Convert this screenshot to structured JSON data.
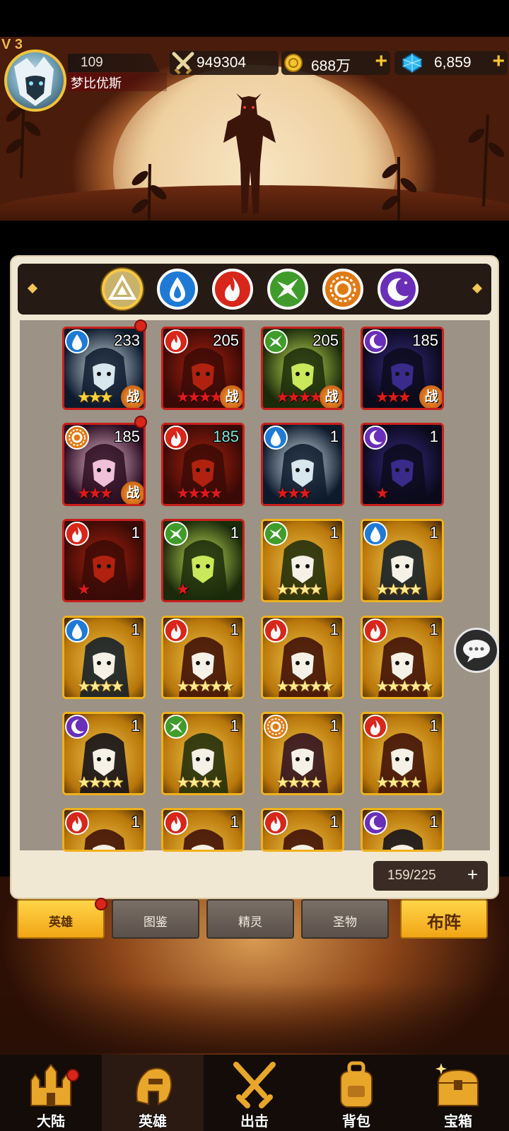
{
  "player": {
    "vip_label": "V 3",
    "level": "109",
    "name": "梦比优斯"
  },
  "resources": {
    "power": "949304",
    "gold": "688万",
    "gems": "6,859",
    "plus": "+"
  },
  "elements": [
    "all",
    "water",
    "fire",
    "wind",
    "light",
    "dark"
  ],
  "heroes": [
    {
      "element": "water",
      "level": "233",
      "stars": 3,
      "star_type": "gold-crown",
      "battle": "战",
      "frame": "red",
      "dot": true
    },
    {
      "element": "fire",
      "level": "205",
      "stars": 4,
      "star_type": "red",
      "battle": "战",
      "frame": "red",
      "dot": false
    },
    {
      "element": "wind",
      "level": "205",
      "stars": 4,
      "star_type": "red",
      "battle": "战",
      "frame": "red",
      "dot": false
    },
    {
      "element": "dark",
      "level": "185",
      "stars": 3,
      "star_type": "red",
      "battle": "战",
      "frame": "red",
      "dot": false
    },
    {
      "element": "light",
      "level": "185",
      "stars": 3,
      "star_type": "red",
      "battle": "战",
      "frame": "red",
      "dot": true
    },
    {
      "element": "fire",
      "level": "185",
      "stars": 4,
      "star_type": "red",
      "battle": "",
      "frame": "red",
      "dot": false,
      "teal": true
    },
    {
      "element": "water",
      "level": "1",
      "stars": 3,
      "star_type": "red",
      "battle": "",
      "frame": "red",
      "dot": false
    },
    {
      "element": "dark",
      "level": "1",
      "stars": 1,
      "star_type": "red",
      "battle": "",
      "frame": "red",
      "dot": false
    },
    {
      "element": "fire",
      "level": "1",
      "stars": 1,
      "star_type": "red",
      "battle": "",
      "frame": "red",
      "dot": false
    },
    {
      "element": "wind",
      "level": "1",
      "stars": 1,
      "star_type": "red",
      "battle": "",
      "frame": "red",
      "dot": false
    },
    {
      "element": "wind",
      "level": "1",
      "stars": 4,
      "star_type": "gold",
      "battle": "",
      "frame": "gold",
      "dot": false
    },
    {
      "element": "water",
      "level": "1",
      "stars": 4,
      "star_type": "gold",
      "battle": "",
      "frame": "gold",
      "dot": false
    },
    {
      "element": "water",
      "level": "1",
      "stars": 4,
      "star_type": "gold",
      "battle": "",
      "frame": "gold",
      "dot": false
    },
    {
      "element": "fire",
      "level": "1",
      "stars": 5,
      "star_type": "gold",
      "battle": "",
      "frame": "gold",
      "dot": false
    },
    {
      "element": "fire",
      "level": "1",
      "stars": 5,
      "star_type": "gold",
      "battle": "",
      "frame": "gold",
      "dot": false
    },
    {
      "element": "fire",
      "level": "1",
      "stars": 5,
      "star_type": "gold",
      "battle": "",
      "frame": "gold",
      "dot": false
    },
    {
      "element": "dark",
      "level": "1",
      "stars": 4,
      "star_type": "gold",
      "battle": "",
      "frame": "gold",
      "dot": false
    },
    {
      "element": "wind",
      "level": "1",
      "stars": 4,
      "star_type": "gold",
      "battle": "",
      "frame": "gold",
      "dot": false
    },
    {
      "element": "light",
      "level": "1",
      "stars": 4,
      "star_type": "gold",
      "battle": "",
      "frame": "gold",
      "dot": false
    },
    {
      "element": "fire",
      "level": "1",
      "stars": 4,
      "star_type": "gold",
      "battle": "",
      "frame": "gold",
      "dot": false
    },
    {
      "element": "fire",
      "level": "1",
      "stars": 0,
      "star_type": "gold",
      "battle": "",
      "frame": "gold",
      "dot": false
    },
    {
      "element": "fire",
      "level": "1",
      "stars": 0,
      "star_type": "gold",
      "battle": "",
      "frame": "gold",
      "dot": false
    },
    {
      "element": "fire",
      "level": "1",
      "stars": 0,
      "star_type": "gold",
      "battle": "",
      "frame": "gold",
      "dot": false
    },
    {
      "element": "dark",
      "level": "1",
      "stars": 0,
      "star_type": "gold",
      "battle": "",
      "frame": "gold",
      "dot": false
    }
  ],
  "hero_count": "159/225",
  "count_plus": "+",
  "subtabs": {
    "heroes": "英雄",
    "codex": "图鉴",
    "spirit": "精灵",
    "relic": "圣物",
    "deploy": "布阵"
  },
  "nav": {
    "continent": "大陆",
    "heroes": "英雄",
    "attack": "出击",
    "bag": "背包",
    "chest": "宝箱"
  },
  "colors": {
    "fire": "#d8261b",
    "water": "#1f7ad6",
    "wind": "#3f9c2a",
    "light": "#e07a12",
    "dark": "#6a2fb8",
    "all": "#c9b36a"
  }
}
